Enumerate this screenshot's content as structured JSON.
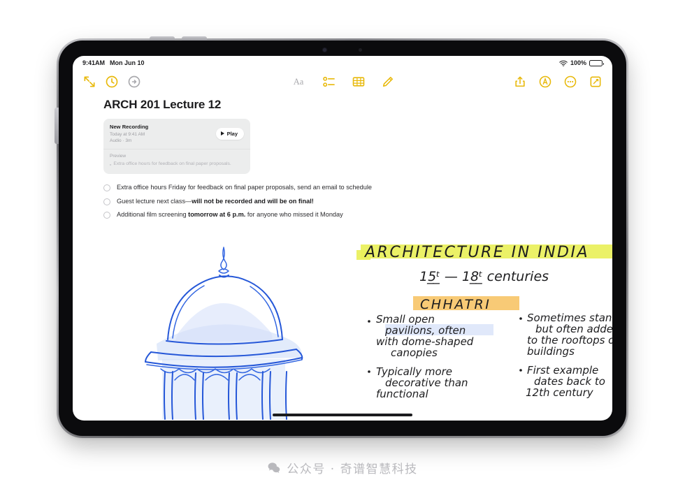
{
  "device": {
    "name": "ipad-tablet",
    "buttons": [
      "volume-up",
      "volume-down",
      "power"
    ]
  },
  "status_bar": {
    "time": "9:41AM",
    "date": "Mon Jun 10",
    "battery_percent": "100%",
    "wifi_icon": "wifi-icon",
    "battery_icon": "battery-icon"
  },
  "toolbar": {
    "left_icons": [
      {
        "name": "collapse-sidebar-icon",
        "color": "#e8b90b"
      },
      {
        "name": "history-clock-icon",
        "color": "#e8b90b"
      },
      {
        "name": "redo-arrow-icon",
        "color": "#c9c9cd"
      }
    ],
    "center_icons": [
      {
        "name": "text-format-icon",
        "label": "Aa",
        "color": "#a9a9ad"
      },
      {
        "name": "checklist-icon",
        "color": "#e8b90b"
      },
      {
        "name": "table-icon",
        "color": "#e8b90b"
      },
      {
        "name": "markup-pen-icon",
        "color": "#e8b90b"
      }
    ],
    "right_icons": [
      {
        "name": "share-icon",
        "color": "#e8b90b"
      },
      {
        "name": "collaborate-icon",
        "color": "#e8b90b"
      },
      {
        "name": "more-options-icon",
        "color": "#e8b90b"
      },
      {
        "name": "compose-new-note-icon",
        "color": "#e8b90b"
      }
    ]
  },
  "note": {
    "title": "ARCH 201 Lecture 12",
    "recording": {
      "title": "New Recording",
      "timestamp": "Today at 9:41 AM",
      "meta": "Audio · 3m",
      "play_label": "Play",
      "preview_label": "Preview",
      "preview_text": "Extra office hours for feedback on final paper proposals."
    },
    "checklist": [
      {
        "checked": false,
        "parts": [
          {
            "text": "Extra office hours Friday for feedback on final paper proposals, send an email to schedule",
            "bold": false
          }
        ]
      },
      {
        "checked": false,
        "parts": [
          {
            "text": "Guest lecture next class—",
            "bold": false
          },
          {
            "text": "will not be recorded and will be on final!",
            "bold": true
          }
        ]
      },
      {
        "checked": false,
        "parts": [
          {
            "text": "Additional film screening ",
            "bold": false
          },
          {
            "text": "tomorrow at 6 p.m.",
            "bold": true
          },
          {
            "text": " for anyone who missed it Monday",
            "bold": false
          }
        ]
      }
    ],
    "handwriting": {
      "heading": "ARCHITECTURE IN INDIA",
      "heading_highlight_color": "#e9f05a",
      "subheading": "15th — 18th centuries",
      "section_title": "CHHATRI",
      "section_highlight_color": "#f7c56a",
      "bullets_left": [
        "Small open pavilions, often with dome-shaped canopies",
        "Typically more decorative than functional"
      ],
      "bullets_right": [
        "Sometimes standalone but often added to the rooftops of buildings",
        "First example dates back to 12th century"
      ],
      "sketch_name": "chhatri-dome-sketch",
      "sketch_ink_color": "#1a4fd6"
    }
  },
  "watermark": {
    "text": "公众号 · 奇谱智慧科技",
    "icon": "wechat-icon"
  }
}
